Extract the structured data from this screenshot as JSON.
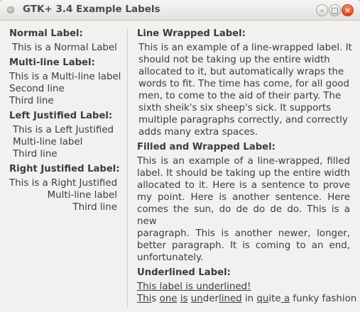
{
  "window": {
    "title": "GTK+ 3.4 Example Labels",
    "buttons": {
      "minimize": "–",
      "maximize": "□",
      "close": "×"
    }
  },
  "left": {
    "normal": {
      "heading": "Normal Label:",
      "text": "This is a Normal Label"
    },
    "multiline": {
      "heading": "Multi-line Label:",
      "lines": [
        "This is a Multi-line label",
        "Second line",
        "Third line"
      ]
    },
    "left_justified": {
      "heading": "Left Justified Label:",
      "lines": [
        "This is a Left Justified",
        "Multi-line label",
        "Third line"
      ]
    },
    "right_justified": {
      "heading": "Right Justified Label:",
      "lines": [
        "This is a Right Justified",
        "Multi-line label",
        "Third line"
      ]
    }
  },
  "right": {
    "wrapped": {
      "heading": "Line Wrapped Label:",
      "lines": [
        "This is an example of a line-wrapped label.  It",
        "should not be taking up the entire width",
        "allocated to it, but automatically wraps the",
        "words to fit.  The time has come, for all good",
        "men, to come to the aid of their party.  The",
        "sixth sheik's six sheep's sick.  It supports",
        "multiple paragraphs correctly, and correctly",
        "adds many extra spaces."
      ]
    },
    "filled": {
      "heading": "Filled and Wrapped Label:",
      "lines": [
        "This is an example of a line-wrapped, filled",
        "label.  It should be taking up the entire width",
        "allocated to it.  Here is a sentence to prove",
        "my point.  Here is another sentence.  Here",
        "comes the sun, do de do de do.  This is a new",
        "paragraph.  This is  another newer, longer,",
        "better  paragraph.  It is coming to an end,",
        "unfortunately."
      ]
    },
    "underlined": {
      "heading": "Underlined Label:",
      "line1": "This label is underlined!",
      "line2_segments": [
        {
          "text": "Thi",
          "u": true
        },
        {
          "text": "s ",
          "u": false
        },
        {
          "text": "one",
          "u": true
        },
        {
          "text": " ",
          "u": false
        },
        {
          "text": "is",
          "u": true
        },
        {
          "text": " ",
          "u": false
        },
        {
          "text": "un",
          "u": true
        },
        {
          "text": "der",
          "u": false
        },
        {
          "text": "lined",
          "u": true
        },
        {
          "text": " in ",
          "u": false
        },
        {
          "text": "qu",
          "u": true
        },
        {
          "text": "ite",
          "u": false
        },
        {
          "text": " a",
          "u": true
        },
        {
          "text": " funky fashion",
          "u": false
        }
      ]
    }
  }
}
